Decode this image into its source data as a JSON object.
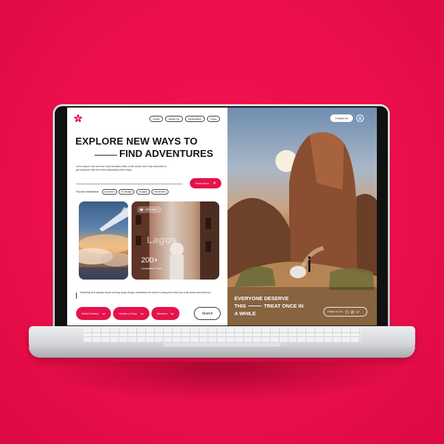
{
  "nav": {
    "items": [
      "Home",
      "About Us",
      "Destination",
      "Tours"
    ],
    "contact_label": "Contact Us"
  },
  "hero": {
    "title_line1": "EXPLORE NEW WAYS TO",
    "title_line2": "FIND ADVENTURES",
    "intro": "Let's explore one and the most beautiful cities of the world, who truly deserves to get explored with the most reasonable price enjoy",
    "read_more_label": "Read More"
  },
  "popular": {
    "label": "Popular Destination",
    "tags": [
      "#London",
      "#Chicago",
      "#Lagos",
      "#Anambra"
    ]
  },
  "city_card": {
    "likes": "200+ Likes",
    "watermark": "Lagos",
    "tours_count": "200+",
    "tours_label": "Completed Tours"
  },
  "quote": "Travelling isn't always about running away things, sometimes it's about running into what you truly wants and deserve",
  "filters": [
    "Select Duration",
    "Number of Days",
    "Members"
  ],
  "search_label": "Search",
  "banner": {
    "line1": "EVERYONE DESERVE",
    "line2a": "THIS",
    "line2b": "TREAT ONCE IN",
    "line3": "A WHILE",
    "follow_label": "Follow Us On:"
  },
  "colors": {
    "accent": "#e5134c",
    "background": "#ec0f4b"
  }
}
